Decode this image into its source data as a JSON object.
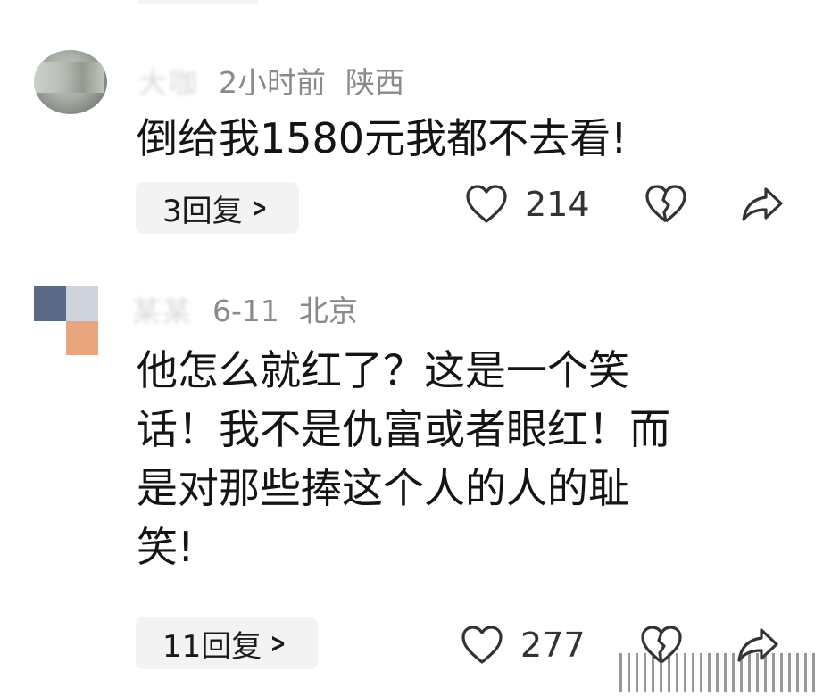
{
  "comments": [
    {
      "username": "大咖",
      "time": "2小时前",
      "location": "陕西",
      "text": "倒给我1580元我都不去看!",
      "replies": "3回复",
      "likes": "214"
    },
    {
      "username": "某某",
      "time": "6-11",
      "location": "北京",
      "text": "他怎么就红了？这是一个笑\n话！我不是仇富或者眼红！而\n是对那些捧这个人的人的耻\n笑!",
      "replies": "11回复",
      "likes": "277"
    }
  ],
  "icons": {
    "reply_arrow": "chevron-right-icon",
    "like": "heart-outline-icon",
    "dislike": "broken-heart-icon",
    "share": "share-arrow-icon"
  },
  "colors": {
    "meta_text": "#8a8a8a",
    "reply_pill_bg": "#f3f3f3",
    "icon_stroke": "#333333"
  }
}
